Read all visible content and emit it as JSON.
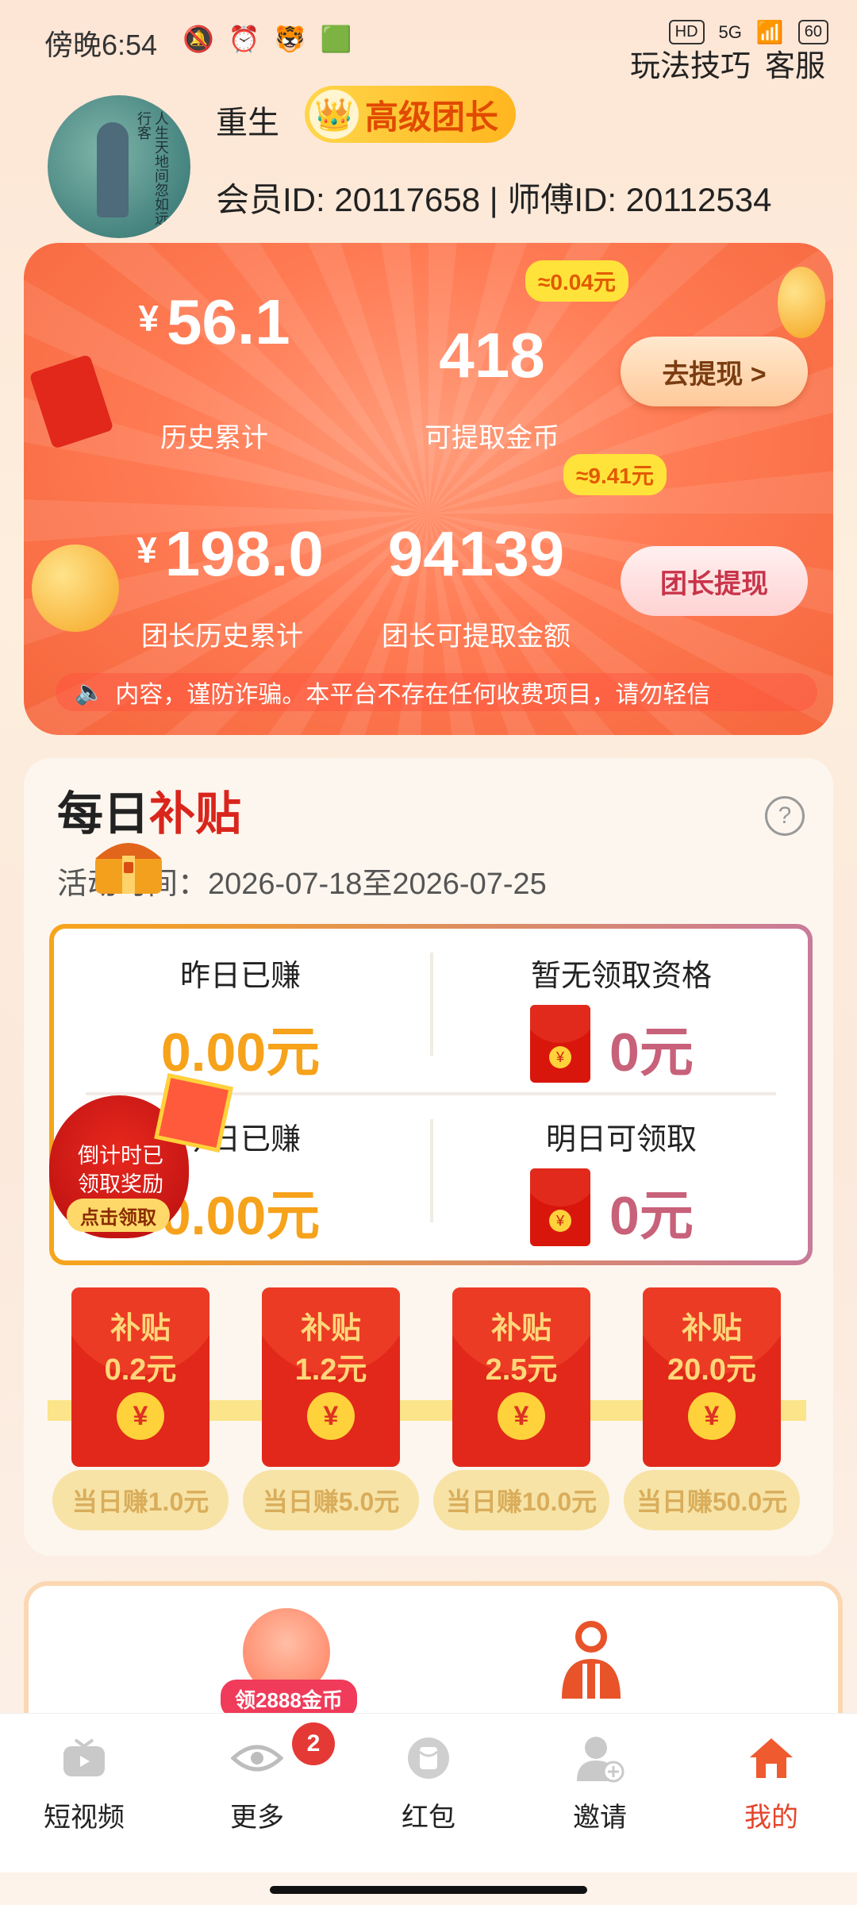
{
  "status_bar": {
    "time": "傍晚6:54",
    "network": "5G",
    "battery": "60",
    "hd": "HD"
  },
  "top_links": {
    "tips": "玩法技巧",
    "service": "客服"
  },
  "profile": {
    "username": "重生",
    "level_badge": "高级团长",
    "ids": "会员ID: 20117658 | 师傅ID: 20112534",
    "avatar_poem": "人生天地间忽如远行客"
  },
  "earnings": {
    "history_total": "56.1",
    "history_total_label": "历史累计",
    "yen": "¥",
    "coins": "418",
    "coins_label": "可提取金币",
    "coins_hint": "≈0.04元",
    "withdraw_button": "去提现 >",
    "leader_history": "198.0",
    "leader_history_label": "团长历史累计",
    "leader_amount": "94139",
    "leader_amount_label": "团长可提取金额",
    "leader_hint": "≈9.41元",
    "leader_withdraw_button": "团长提现",
    "ticker": "内容，谨防诈骗。本平台不存在任何收费项目，请勿轻信"
  },
  "daily": {
    "title_a": "每日",
    "title_b": "补贴",
    "period": "活动时间：2026-07-18至2026-07-25",
    "cells": [
      {
        "title": "昨日已赚",
        "value": "0.00元"
      },
      {
        "title": "暂无领取资格",
        "value": "0元"
      },
      {
        "title": "今日已赚",
        "value": "0.00元"
      },
      {
        "title": "明日可领取",
        "value": "0元"
      }
    ],
    "countdown_bag": {
      "line1": "倒计时已",
      "line2": "领取奖励",
      "button": "点击领取"
    },
    "rewards": [
      {
        "label": "补贴",
        "amount": "0.2元",
        "condition": "当日赚1.0元"
      },
      {
        "label": "补贴",
        "amount": "1.2元",
        "condition": "当日赚5.0元"
      },
      {
        "label": "补贴",
        "amount": "2.5元",
        "condition": "当日赚10.0元"
      },
      {
        "label": "补贴",
        "amount": "20.0元",
        "condition": "当日赚50.0元"
      }
    ]
  },
  "promo": {
    "gift_tag": "领2888金币"
  },
  "tabs": [
    {
      "label": "短视频",
      "icon": "tv-icon"
    },
    {
      "label": "更多",
      "icon": "eye-icon",
      "badge": "2"
    },
    {
      "label": "红包",
      "icon": "red-packet-icon"
    },
    {
      "label": "邀请",
      "icon": "add-user-icon"
    },
    {
      "label": "我的",
      "icon": "home-icon",
      "active": true
    }
  ],
  "colors": {
    "accent": "#e6442b",
    "card_orange": "#ff7b54",
    "gold": "#f6a21b",
    "pink_value": "#c8617a"
  }
}
